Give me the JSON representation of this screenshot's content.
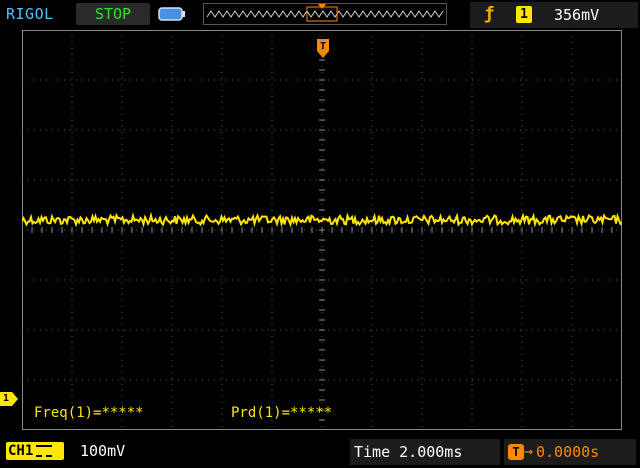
{
  "header": {
    "brand": "RIGOL",
    "run_state": "STOP",
    "trigger": {
      "edge_icon": "rising-edge-icon",
      "source": "1",
      "level": "356mV"
    },
    "trigger_marker_label": "T"
  },
  "channel_marker_label": "1",
  "measurements": [
    {
      "label": "Freq(1)",
      "value": "=*****"
    },
    {
      "label": "Prd(1)",
      "value": "=*****"
    }
  ],
  "footer": {
    "channel": "CH1",
    "channel_scale": "100mV",
    "timebase_label": "Time",
    "timebase_value": "2.000ms",
    "trigger_offset": "0.0000s",
    "trigger_offset_icon": "T"
  },
  "colors": {
    "channel1": "#ffe600",
    "trigger": "#ff8a00",
    "brand": "#4fc3ff",
    "run_state": "#2fe22f",
    "grid": "#6a6a6a"
  },
  "icons": {
    "battery": "battery-icon",
    "timeline": "memory-timeline-icon",
    "coupling": "dc-coupling-icon"
  }
}
